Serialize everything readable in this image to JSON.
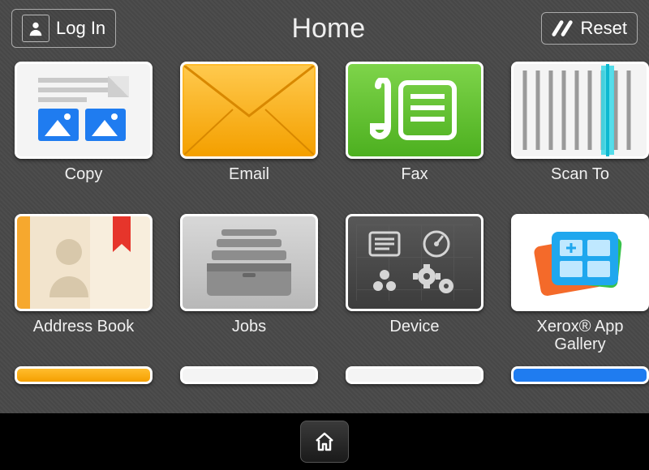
{
  "header": {
    "login_label": "Log In",
    "title": "Home",
    "reset_label": "Reset"
  },
  "apps": [
    {
      "id": "copy",
      "label": "Copy"
    },
    {
      "id": "email",
      "label": "Email"
    },
    {
      "id": "fax",
      "label": "Fax"
    },
    {
      "id": "scan-to",
      "label": "Scan To"
    },
    {
      "id": "address-book",
      "label": "Address Book"
    },
    {
      "id": "jobs",
      "label": "Jobs"
    },
    {
      "id": "device",
      "label": "Device"
    },
    {
      "id": "app-gallery",
      "label": "Xerox® App Gallery"
    }
  ],
  "footer": {
    "home_label": "Home"
  }
}
